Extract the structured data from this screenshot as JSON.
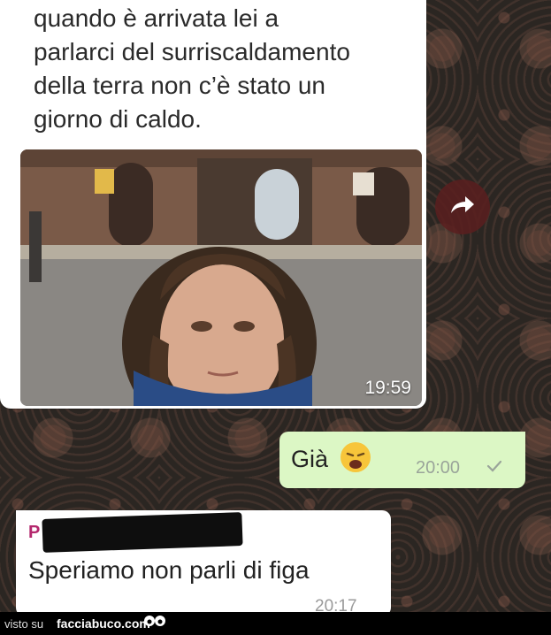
{
  "chat": {
    "image_message": {
      "caption": "quando è arrivata lei a\nparlarci del surriscaldamento\ndella terra non c’è  stato un\ngiorno di caldo.",
      "time": "19:59"
    },
    "forward_icon": "share-arrow-icon",
    "outgoing_message": {
      "text": "Già",
      "emoji": "weary-face-emoji",
      "time": "20:00",
      "status_icon": "single-check-icon"
    },
    "incoming_message": {
      "sender_initial": "P",
      "text": "Speriamo non parli di figa",
      "time": "20:17"
    }
  },
  "footer": {
    "visto_label": "visto su",
    "site_label": "facciabuco.com"
  },
  "colors": {
    "outgoing_bubble": "#dcf7c5",
    "incoming_bubble": "#ffffff",
    "sender_name": "#b4276d",
    "forward_button": "#5a1e1e"
  }
}
